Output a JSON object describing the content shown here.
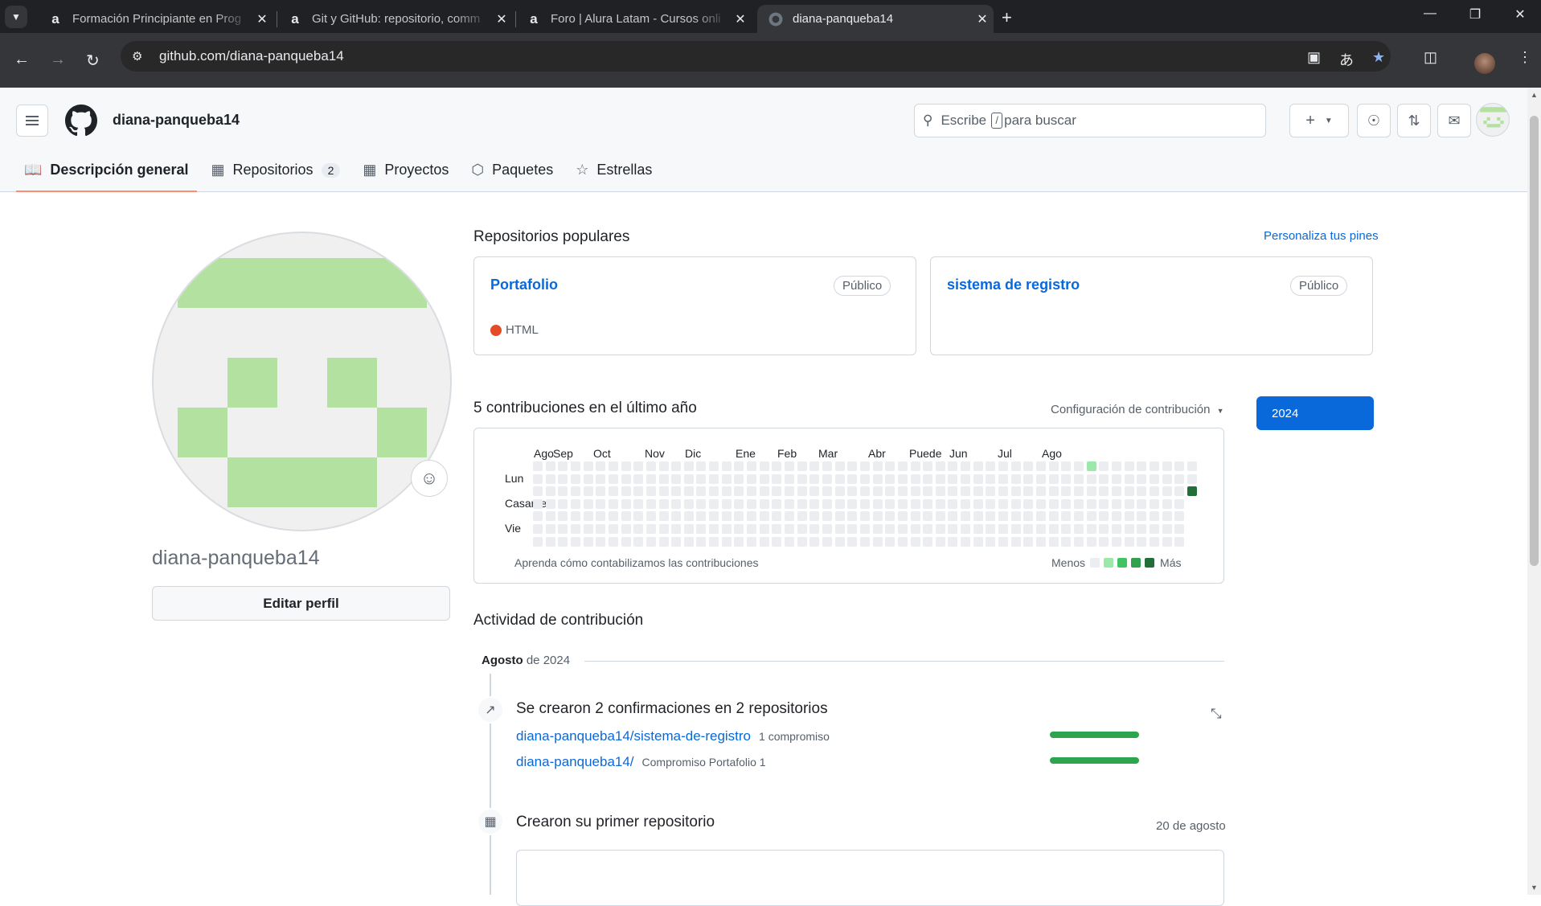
{
  "browser": {
    "tabs": [
      {
        "title": "Formación Principiante en Prog",
        "favicon": "alura-icon"
      },
      {
        "title": "Git y GitHub: repositorio, comm",
        "favicon": "alura-icon"
      },
      {
        "title": "Foro | Alura Latam - Cursos onli",
        "favicon": "alura-icon"
      },
      {
        "title": "diana-panqueba14",
        "favicon": "github-icon",
        "active": true
      }
    ],
    "url": "github.com/diana-panqueba14"
  },
  "header": {
    "username": "diana-panqueba14",
    "search": {
      "prefix": "Escribe",
      "key": "/",
      "suffix": "para buscar"
    }
  },
  "nav": {
    "items": [
      {
        "label": "Descripción general",
        "icon": "book-icon"
      },
      {
        "label": "Repositorios",
        "icon": "repo-icon",
        "count": "2"
      },
      {
        "label": "Proyectos",
        "icon": "table-icon"
      },
      {
        "label": "Paquetes",
        "icon": "package-icon"
      },
      {
        "label": "Estrellas",
        "icon": "star-icon"
      }
    ]
  },
  "profile": {
    "username": "diana-panqueba14",
    "edit_label": "Editar perfil"
  },
  "pinned": {
    "title": "Repositorios populares",
    "customize": "Personaliza tus pines",
    "repos": [
      {
        "name": "Portafolio",
        "visibility": "Público",
        "language": "HTML",
        "language_color": "#e34c26"
      },
      {
        "name": "sistema de registro",
        "visibility": "Público"
      }
    ]
  },
  "contributions": {
    "title": "5 contribuciones en el último año",
    "settings": "Configuración de contribución",
    "year": "2024",
    "months": [
      "Ago",
      "Sep",
      "Oct",
      "Nov",
      "Dic",
      "Ene",
      "Feb",
      "Mar",
      "Abr",
      "Puede",
      "Jun",
      "Jul",
      "Ago"
    ],
    "days": [
      "Lun",
      "Casarse",
      "Vie"
    ],
    "learn": "Aprenda cómo contabilizamos las contribuciones",
    "less": "Menos",
    "more": "Más",
    "legend_colors": [
      "#ebedf0",
      "#9be9a8",
      "#40c463",
      "#30a14e",
      "#216e39"
    ]
  },
  "activity": {
    "title": "Actividad de contribución",
    "month": "Agosto",
    "year": "de 2024",
    "commits_summary": "Se crearon 2 confirmaciones en 2 repositorios",
    "commit_rows": [
      {
        "repo": "diana-panqueba14/sistema-de-registro",
        "count": "1 compromiso"
      },
      {
        "repo": "diana-panqueba14/",
        "count": "Compromiso Portafolio 1"
      }
    ],
    "first_repo": "Crearon su primer repositorio",
    "first_repo_date": "20 de agosto"
  }
}
